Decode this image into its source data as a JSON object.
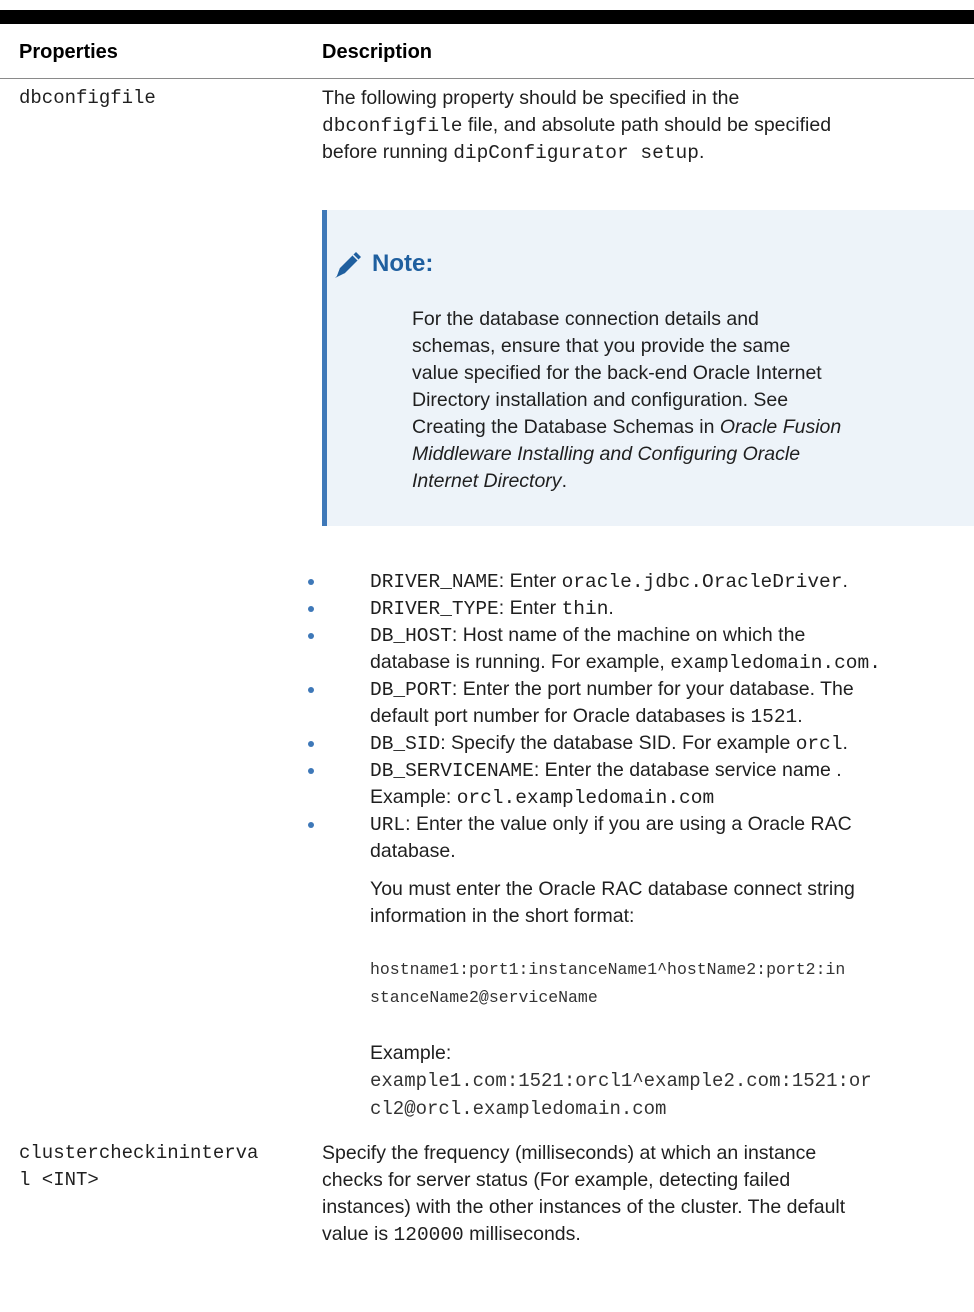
{
  "table": {
    "headers": {
      "properties": "Properties",
      "description": "Description"
    },
    "row1": {
      "property": "dbconfigfile",
      "intro": {
        "l1": "The following property should be specified in the",
        "l2_code": "dbconfigfile",
        "l2_text": " file, and absolute path should be specified",
        "l3_text": "before running ",
        "l3_code": "dipConfigurator setup",
        "l3_end": "."
      },
      "note": {
        "title": "Note:",
        "l1": "For the database connection details and",
        "l2": "schemas, ensure that you provide the same",
        "l3": "value specified for the back-end Oracle Internet",
        "l4": "Directory installation and configuration. See",
        "l5_text": "Creating the Database Schemas in ",
        "l5_italic": "Oracle Fusion",
        "l6_italic": "Middleware Installing and Configuring Oracle",
        "l7_italic": "Internet Directory",
        "l7_end": "."
      },
      "bullets": {
        "b1_code": "DRIVER_NAME",
        "b1_text": ": Enter ",
        "b1_val": "oracle.jdbc.OracleDriver",
        "b1_end": ".",
        "b2_code": "DRIVER_TYPE",
        "b2_text": ": Enter ",
        "b2_val": "thin",
        "b2_end": ".",
        "b3_code": "DB_HOST",
        "b3_text": ": Host name of the machine on which the",
        "b3_l2_text": "database is running. For example, ",
        "b3_l2_val": "exampledomain.com.",
        "b4_code": "DB_PORT",
        "b4_text": ": Enter the port number for your database. The",
        "b4_l2_text": "default port number for Oracle databases is ",
        "b4_l2_val": "1521",
        "b4_l2_end": ".",
        "b5_code": "DB_SID",
        "b5_text": ": Specify the database SID. For example ",
        "b5_val": "orcl",
        "b5_end": ".",
        "b6_code": "DB_SERVICENAME",
        "b6_text": ": Enter the database service name .",
        "b6_l2_text": "Example: ",
        "b6_l2_val": "orcl.exampledomain.com",
        "b7_code": "URL",
        "b7_text": ": Enter the value only if you are using a Oracle RAC",
        "b7_l2": "database."
      },
      "rac": {
        "l1": "You must enter the Oracle RAC database connect string",
        "l2": "information in the short format:",
        "code1": "hostname1:port1:instanceName1^hostName2:port2:in",
        "code2": "stanceName2@serviceName",
        "example_label": "Example:",
        "ex1": "example1.com:1521:orcl1^example2.com:1521:or",
        "ex2": "cl2@orcl.exampledomain.com"
      }
    },
    "row2": {
      "property_l1": "clustercheckininterva",
      "property_l2": "l <INT>",
      "l1": "Specify the frequency (milliseconds) at which an instance",
      "l2": "checks for server status (For example, detecting failed",
      "l3": "instances) with the other instances of the cluster. The default",
      "l4_text": "value is ",
      "l4_val": "120000",
      "l4_end": " milliseconds."
    }
  }
}
